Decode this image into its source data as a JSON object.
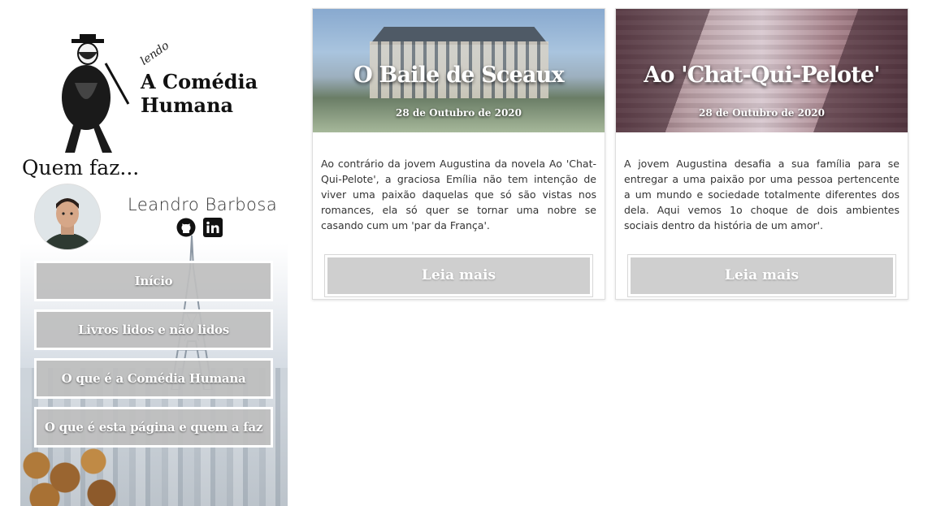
{
  "sidebar": {
    "logo": {
      "kicker": "lendo",
      "title": "A Comédia Humana"
    },
    "quem_faz_heading": "Quem faz...",
    "author": {
      "name": "Leandro Barbosa"
    },
    "social_icons": [
      "github-icon",
      "linkedin-icon"
    ],
    "nav": [
      {
        "label": "Início"
      },
      {
        "label": "Livros lidos e não lidos"
      },
      {
        "label": "O que é a Comédia Humana"
      },
      {
        "label": "O que é esta página e quem a faz"
      }
    ]
  },
  "cards": [
    {
      "title": "O Baile de Sceaux",
      "date": "28 de Outubro de 2020",
      "text": "Ao contrário da jovem Augustina da novela Ao 'Chat-Qui-Pelote', a graciosa Emília não tem intenção de viver uma paixão daquelas que só são vistas nos romances, ela só quer se tornar uma nobre se casando cum um 'par da França'.",
      "button": "Leia mais"
    },
    {
      "title": "Ao 'Chat-Qui-Pelote'",
      "date": "28 de Outubro de 2020",
      "text": "A jovem Augustina desafia a sua família para se entregar a uma paixão por uma pessoa pertencente a um mundo e sociedade totalmente diferentes dos dela. Aqui vemos 1o choque de dois ambientes sociais dentro da história de um amor'.",
      "button": "Leia mais"
    }
  ],
  "colors": {
    "nav_button_bg": "#bebebe",
    "card_button_bg": "#cfcfcf",
    "text": "#333333"
  }
}
